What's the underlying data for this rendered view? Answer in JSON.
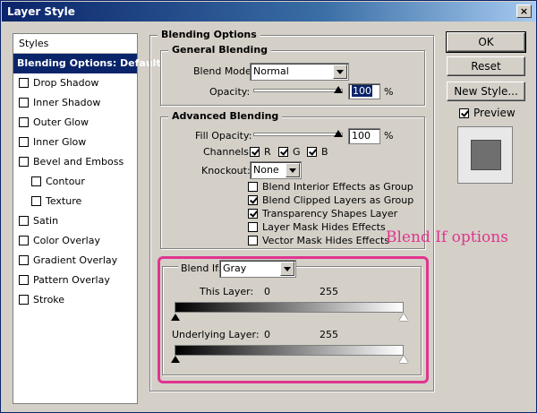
{
  "window": {
    "title": "Layer Style",
    "close_glyph": "×"
  },
  "styles_list": {
    "header": "Styles",
    "selected": "Blending Options: Default",
    "items": [
      {
        "label": "Drop Shadow"
      },
      {
        "label": "Inner Shadow"
      },
      {
        "label": "Outer Glow"
      },
      {
        "label": "Inner Glow"
      },
      {
        "label": "Bevel and Emboss"
      },
      {
        "label": "Contour"
      },
      {
        "label": "Texture"
      },
      {
        "label": "Satin"
      },
      {
        "label": "Color Overlay"
      },
      {
        "label": "Gradient Overlay"
      },
      {
        "label": "Pattern Overlay"
      },
      {
        "label": "Stroke"
      }
    ]
  },
  "blending_options": {
    "title": "Blending Options",
    "general": {
      "title": "General Blending",
      "blend_mode_label": "Blend Mode:",
      "blend_mode_value": "Normal",
      "opacity_label": "Opacity:",
      "opacity_value": "100",
      "opacity_unit": "%"
    },
    "advanced": {
      "title": "Advanced Blending",
      "fill_opacity_label": "Fill Opacity:",
      "fill_opacity_value": "100",
      "fill_opacity_unit": "%",
      "channels_label": "Channels:",
      "channel_r": "R",
      "channel_g": "G",
      "channel_b": "B",
      "knockout_label": "Knockout:",
      "knockout_value": "None",
      "options": [
        {
          "label": "Blend Interior Effects as Group",
          "checked": false
        },
        {
          "label": "Blend Clipped Layers as Group",
          "checked": true
        },
        {
          "label": "Transparency Shapes Layer",
          "checked": true
        },
        {
          "label": "Layer Mask Hides Effects",
          "checked": false
        },
        {
          "label": "Vector Mask Hides Effects",
          "checked": false
        }
      ]
    },
    "blend_if": {
      "label": "Blend If:",
      "value": "Gray",
      "this_layer_label": "This Layer:",
      "this_layer_min": "0",
      "this_layer_max": "255",
      "underlying_label": "Underlying Layer:",
      "underlying_min": "0",
      "underlying_max": "255"
    }
  },
  "buttons": {
    "ok": "OK",
    "reset": "Reset",
    "new_style": "New Style...",
    "preview_label": "Preview"
  },
  "annotation": {
    "text": "Blend If options",
    "color": "#e0348f"
  }
}
